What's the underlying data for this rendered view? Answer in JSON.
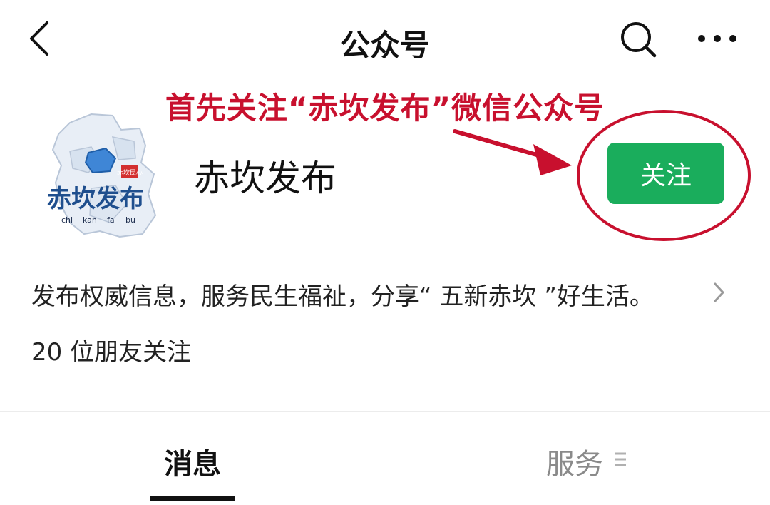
{
  "header": {
    "title": "公众号",
    "icons": [
      "back-icon",
      "search-icon",
      "more-icon"
    ]
  },
  "annotation": {
    "text": "首先关注“赤坎发布”微信公众号",
    "color": "#c8102e"
  },
  "account": {
    "name": "赤坎发布",
    "logo": {
      "title": "赤坎发布",
      "pinyin": [
        "chi",
        "kan",
        "fa",
        "bu"
      ],
      "stamp": "赤坎民心"
    },
    "follow_label": "关注",
    "follow_color": "#1aad5c",
    "description": "发布权威信息，服务民生福祉，分享“ 五新赤坎 ”好生活。",
    "friends_count": "20 位朋友关注"
  },
  "tabs": [
    {
      "label": "消息",
      "active": true
    },
    {
      "label": "服务",
      "active": false,
      "icon": "menu-icon"
    }
  ]
}
